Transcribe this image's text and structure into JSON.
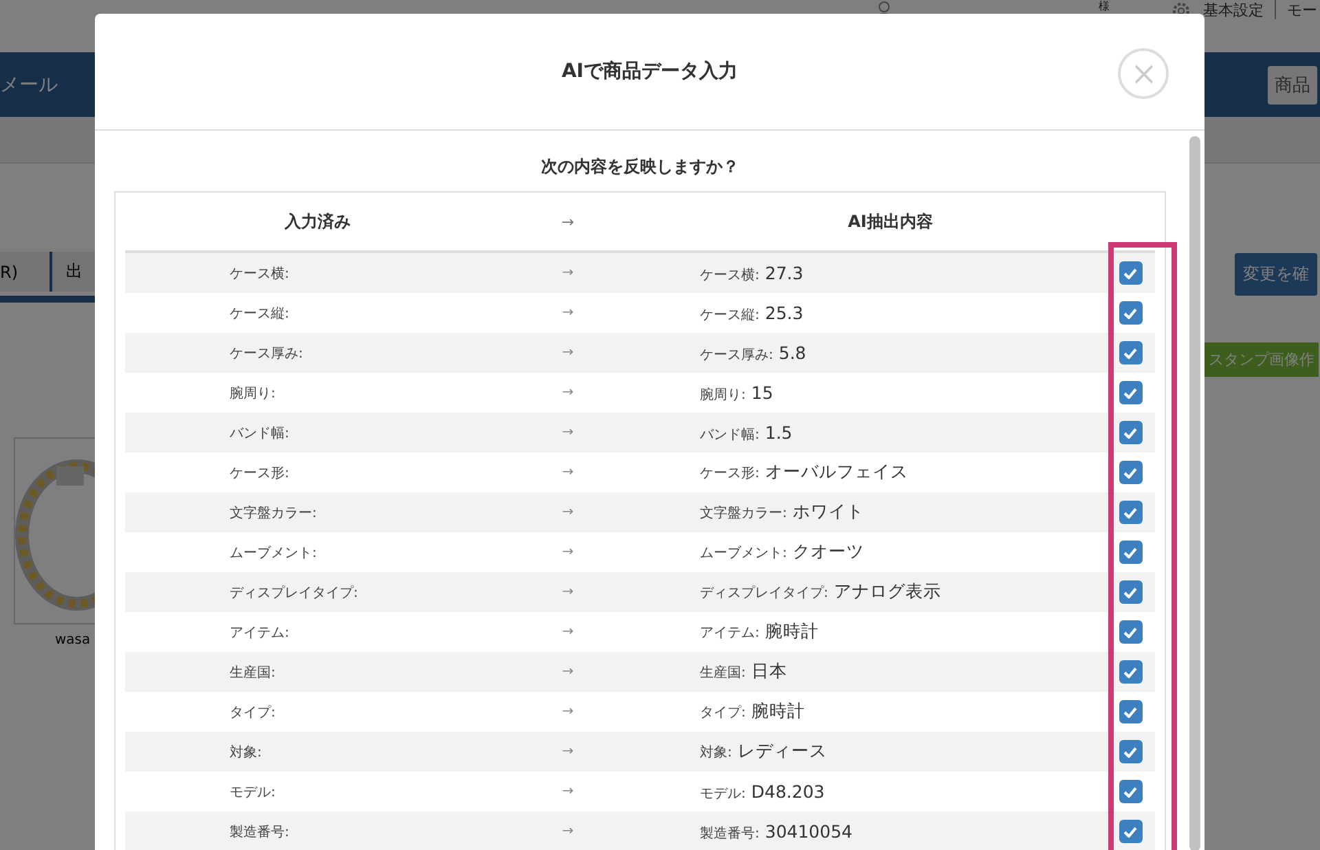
{
  "background": {
    "account_suffix": "様",
    "settings_link": "基本設定",
    "mode_link": "モー",
    "nav_title": "メール",
    "nav_button": "商品",
    "tabs": [
      {
        "label": "R)"
      },
      {
        "label": "出"
      }
    ],
    "confirm_button": "変更を確",
    "stamp_button": "スタンプ画像作",
    "product_caption": "wasa"
  },
  "dialog": {
    "title": "AIで商品データ入力",
    "question": "次の内容を反映しますか？",
    "columns": {
      "current": "入力済み",
      "arrow": "→",
      "extracted": "AI抽出内容"
    },
    "rows": [
      {
        "label": "ケース横:",
        "arrow": "→",
        "ai_label": "ケース横:",
        "ai_value": "27.3",
        "checked": true
      },
      {
        "label": "ケース縦:",
        "arrow": "→",
        "ai_label": "ケース縦:",
        "ai_value": "25.3",
        "checked": true
      },
      {
        "label": "ケース厚み:",
        "arrow": "→",
        "ai_label": "ケース厚み:",
        "ai_value": "5.8",
        "checked": true
      },
      {
        "label": "腕周り:",
        "arrow": "→",
        "ai_label": "腕周り:",
        "ai_value": "15",
        "checked": true
      },
      {
        "label": "バンド幅:",
        "arrow": "→",
        "ai_label": "バンド幅:",
        "ai_value": "1.5",
        "checked": true
      },
      {
        "label": "ケース形:",
        "arrow": "→",
        "ai_label": "ケース形:",
        "ai_value": "オーバルフェイス",
        "checked": true
      },
      {
        "label": "文字盤カラー:",
        "arrow": "→",
        "ai_label": "文字盤カラー:",
        "ai_value": "ホワイト",
        "checked": true
      },
      {
        "label": "ムーブメント:",
        "arrow": "→",
        "ai_label": "ムーブメント:",
        "ai_value": "クオーツ",
        "checked": true
      },
      {
        "label": "ディスプレイタイプ:",
        "arrow": "→",
        "ai_label": "ディスプレイタイプ:",
        "ai_value": "アナログ表示",
        "checked": true
      },
      {
        "label": "アイテム:",
        "arrow": "→",
        "ai_label": "アイテム:",
        "ai_value": "腕時計",
        "checked": true
      },
      {
        "label": "生産国:",
        "arrow": "→",
        "ai_label": "生産国:",
        "ai_value": "日本",
        "checked": true
      },
      {
        "label": "タイプ:",
        "arrow": "→",
        "ai_label": "タイプ:",
        "ai_value": "腕時計",
        "checked": true
      },
      {
        "label": "対象:",
        "arrow": "→",
        "ai_label": "対象:",
        "ai_value": "レディース",
        "checked": true
      },
      {
        "label": "モデル:",
        "arrow": "→",
        "ai_label": "モデル:",
        "ai_value": "D48.203",
        "checked": true
      },
      {
        "label": "製造番号:",
        "arrow": "→",
        "ai_label": "製造番号:",
        "ai_value": "30410054",
        "checked": true
      }
    ]
  }
}
